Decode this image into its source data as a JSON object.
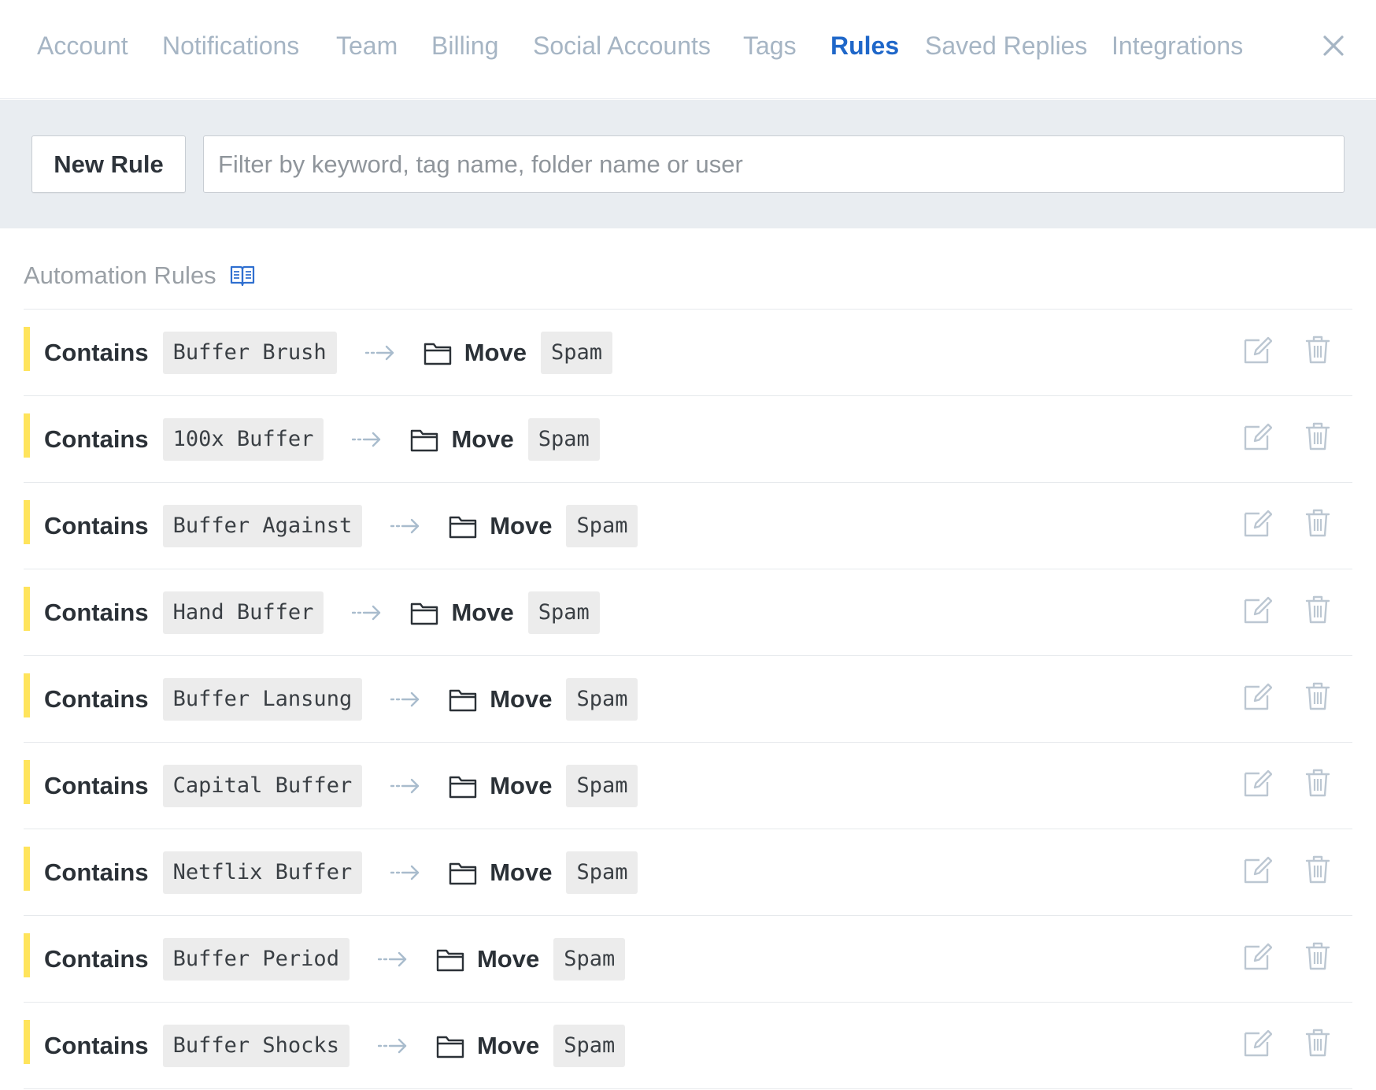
{
  "nav": {
    "tabs": [
      {
        "label": "Account",
        "active": false
      },
      {
        "label": "Notifications",
        "active": false
      },
      {
        "label": "Team",
        "active": false
      },
      {
        "label": "Billing",
        "active": false
      },
      {
        "label": "Social Accounts",
        "active": false
      },
      {
        "label": "Tags",
        "active": false
      },
      {
        "label": "Rules",
        "active": true
      },
      {
        "label": "Saved Replies",
        "active": false
      },
      {
        "label": "Integrations",
        "active": false
      }
    ],
    "close_icon": "close-icon"
  },
  "toolbar": {
    "new_rule_label": "New Rule",
    "filter_placeholder": "Filter by keyword, tag name, folder name or user",
    "filter_value": ""
  },
  "section": {
    "title": "Automation Rules",
    "help_icon": "book-icon"
  },
  "rules": [
    {
      "condition": "Contains",
      "keyword": "Buffer Brush",
      "action": "Move",
      "target": "Spam"
    },
    {
      "condition": "Contains",
      "keyword": "100x Buffer",
      "action": "Move",
      "target": "Spam"
    },
    {
      "condition": "Contains",
      "keyword": "Buffer Against",
      "action": "Move",
      "target": "Spam"
    },
    {
      "condition": "Contains",
      "keyword": "Hand Buffer",
      "action": "Move",
      "target": "Spam"
    },
    {
      "condition": "Contains",
      "keyword": "Buffer Lansung",
      "action": "Move",
      "target": "Spam"
    },
    {
      "condition": "Contains",
      "keyword": "Capital Buffer",
      "action": "Move",
      "target": "Spam"
    },
    {
      "condition": "Contains",
      "keyword": "Netflix Buffer",
      "action": "Move",
      "target": "Spam"
    },
    {
      "condition": "Contains",
      "keyword": "Buffer Period",
      "action": "Move",
      "target": "Spam"
    },
    {
      "condition": "Contains",
      "keyword": "Buffer Shocks",
      "action": "Move",
      "target": "Spam"
    }
  ],
  "colors": {
    "accent": "#1f67c9",
    "tab_inactive": "#a6b5c4",
    "rule_bar": "#ffe45c",
    "toolbar_bg": "#e9edf1"
  }
}
